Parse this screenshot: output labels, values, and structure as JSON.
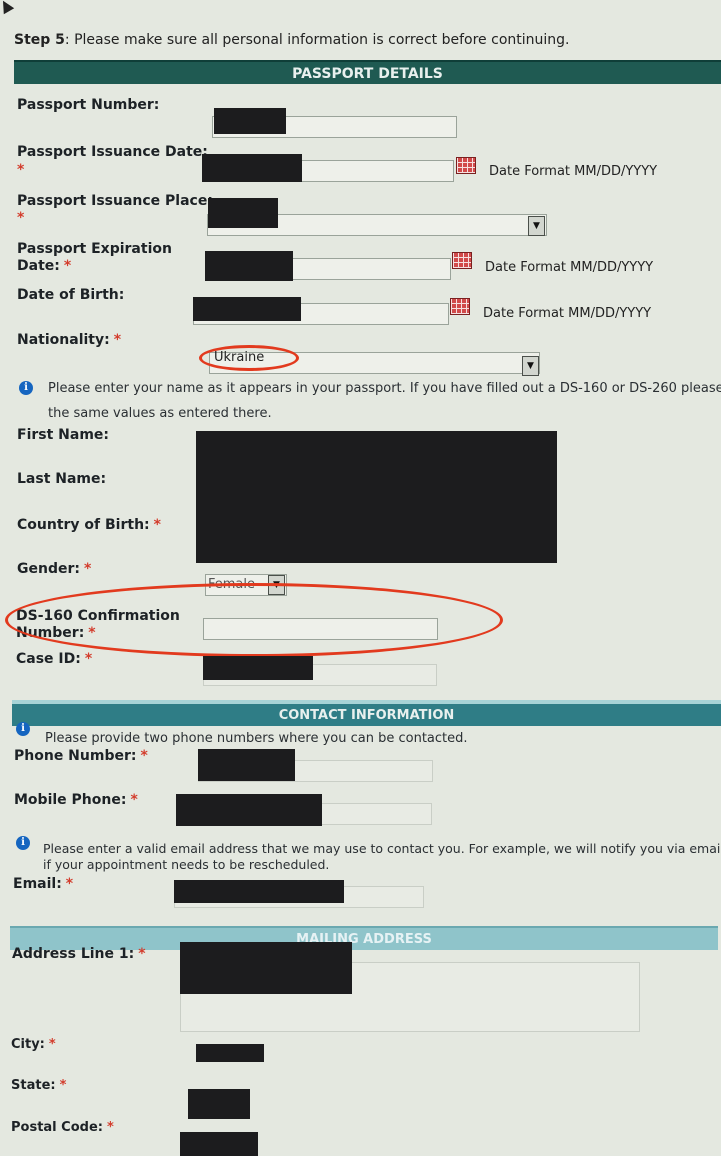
{
  "step": {
    "prefix": "Step 5",
    "text": ": Please make sure all personal information is correct before continuing."
  },
  "sections": {
    "passport": "PASSPORT DETAILS",
    "contact": "CONTACT INFORMATION",
    "mailing": "MAILING ADDRESS"
  },
  "fields": {
    "passport_number": "Passport Number:",
    "issuance_date": "Passport Issuance Date:",
    "issuance_place": "Passport Issuance Place:",
    "expiration_line1": "Passport Expiration",
    "expiration_line2": "Date:",
    "date_of_birth": "Date of Birth:",
    "nationality": "Nationality:",
    "first_name": "First Name:",
    "last_name": "Last Name:",
    "country_of_birth": "Country of Birth:",
    "gender": "Gender:",
    "ds160_line1": "DS-160 Confirmation",
    "ds160_line2": "Number:",
    "case_id": "Case ID:",
    "phone": "Phone Number:",
    "mobile": "Mobile Phone:",
    "email": "Email:",
    "address1": "Address Line 1:",
    "city": "City:",
    "state": "State:",
    "postal": "Postal Code:"
  },
  "required_mark": "*",
  "date_format": "Date Format MM/DD/YYYY",
  "nationality_value": "Ukraine",
  "gender_value": "Female",
  "info": {
    "passport_line1": "Please enter your name as it appears in your passport. If you have filled out a DS-160 or DS-260 please",
    "passport_line2": "the same values as entered there.",
    "contact": "Please provide two phone numbers where you can be contacted.",
    "email_line1": "Please enter a valid email address that we may use to contact you. For example, we will notify you via email",
    "email_line2": "if your appointment needs to be rescheduled."
  },
  "icons": {
    "info": "i",
    "select_arrow": "▼"
  },
  "colors": {
    "header_dark": "#1f5a52",
    "header_mid": "#2f7d86",
    "header_light": "#8fc4ca",
    "required": "#d33c2c",
    "highlight": "#e23a1e"
  }
}
